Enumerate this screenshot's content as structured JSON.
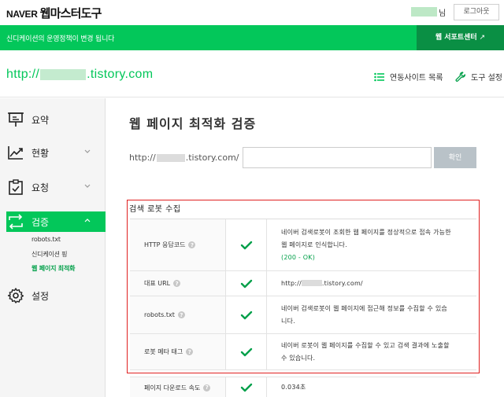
{
  "header": {
    "brand": "NAVER",
    "title": "웹마스터도구",
    "user_suffix": "님",
    "logout_label": "로그아웃"
  },
  "notice": {
    "text": "신디케이션의 운영정책이 변경 됩니다",
    "support_label": "웹 서포트센터",
    "support_icon": "↗"
  },
  "site": {
    "url_prefix": "http://",
    "url_suffix": ".tistory.com",
    "links_label": "연동사이트 목록",
    "tools_label": "도구 설정"
  },
  "sidebar": {
    "items": [
      {
        "label": "요약",
        "icon": "presentation-icon"
      },
      {
        "label": "현황",
        "icon": "trend-chart-icon"
      },
      {
        "label": "요청",
        "icon": "clipboard-check-icon"
      },
      {
        "label": "검증",
        "icon": "transfer-icon"
      },
      {
        "label": "설정",
        "icon": "gear-icon"
      }
    ],
    "subitems": [
      "robots.txt",
      "신디케이션 핑",
      "웹 페이지 최적화"
    ]
  },
  "main": {
    "title": "웹 페이지 최적화 검증",
    "url_prefix": "http://",
    "url_suffix": ".tistory.com/",
    "input_value": "",
    "confirm_label": "확인",
    "section_title": "검색 로봇 수집",
    "rows": [
      {
        "label": "HTTP 응답코드",
        "line1": "네이버 검색로봇이 조회한 웹 페이지를 정상적으로 접속 가능한",
        "line2": "웹 페이지로 인식합니다.",
        "line3": "(200 - OK)"
      },
      {
        "label": "대표 URL",
        "line1": "http://",
        "line2": ".tistory.com/"
      },
      {
        "label": "robots.txt",
        "line1": "네이버 검색로봇이 웹 페이지에 접근해 정보를 수집할 수 있습",
        "line2": "니다."
      },
      {
        "label": "로봇 메타 태그",
        "line1": "네이버 로봇이 웹 페이지를 수집할 수 있고 검색 결과에 노출할",
        "line2": "수 있습니다."
      },
      {
        "label": "페이지 다운로드 속도",
        "line1": "0.034초"
      }
    ]
  },
  "colors": {
    "brand_green": "#03c75a",
    "dark_green": "#0a8f44",
    "highlight_red": "#e02020",
    "check_green": "#03a04a"
  }
}
